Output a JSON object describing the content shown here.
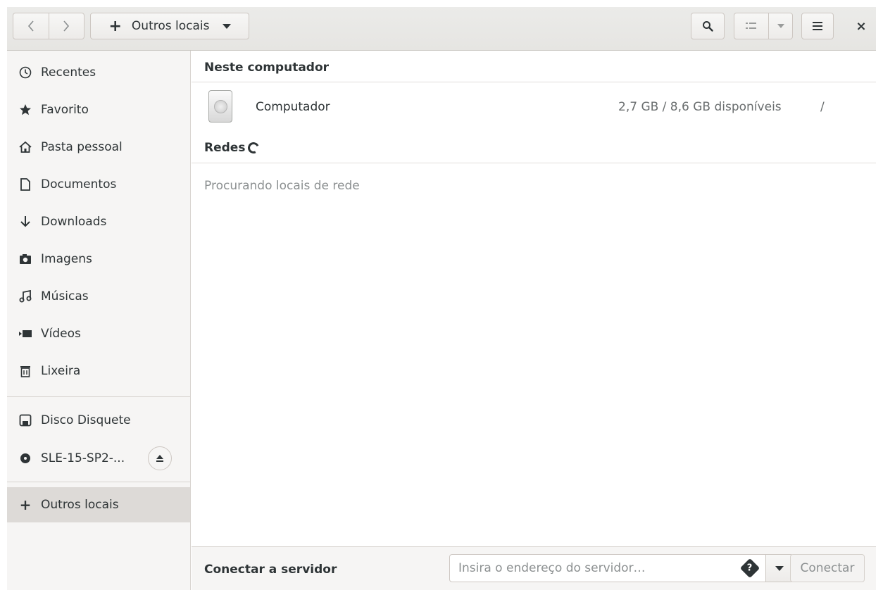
{
  "header": {
    "back_icon": "chevron-left-icon",
    "forward_icon": "chevron-right-icon",
    "location_label": "Outros locais",
    "search_icon": "search-icon",
    "view_icon": "list-view-icon",
    "menu_icon": "hamburger-menu-icon",
    "close_glyph": "×"
  },
  "sidebar": {
    "items": [
      {
        "label": "Recentes",
        "icon": "clock-icon"
      },
      {
        "label": "Favorito",
        "icon": "star-icon"
      },
      {
        "label": "Pasta pessoal",
        "icon": "home-icon"
      },
      {
        "label": "Documentos",
        "icon": "document-icon"
      },
      {
        "label": "Downloads",
        "icon": "download-icon"
      },
      {
        "label": "Imagens",
        "icon": "camera-icon"
      },
      {
        "label": "Músicas",
        "icon": "music-icon"
      },
      {
        "label": "Vídeos",
        "icon": "video-icon"
      },
      {
        "label": "Lixeira",
        "icon": "trash-icon"
      }
    ],
    "devices": [
      {
        "label": "Disco Disquete",
        "icon": "floppy-icon"
      },
      {
        "label": "SLE-15-SP2-...",
        "icon": "disc-icon",
        "eject_icon": "eject-icon"
      }
    ],
    "other": {
      "label": "Outros locais",
      "icon": "plus-icon"
    }
  },
  "main": {
    "section_computer": "Neste computador",
    "computer": {
      "name": "Computador",
      "space": "2,7 GB / 8,6 GB disponíveis",
      "path": "/",
      "icon": "hard-disk-icon"
    },
    "section_networks": "Redes",
    "searching_text": "Procurando locais de rede"
  },
  "bottom": {
    "connect_label": "Conectar a servidor",
    "server_placeholder": "Insira o endereço do servidor…",
    "connect_button": "Conectar"
  },
  "colors": {
    "sidebar_bg": "#f6f5f4",
    "selected_bg": "#dddad7",
    "header_bg": "#e8e7e4",
    "text": "#2e3436",
    "muted_text": "#8c9091"
  }
}
